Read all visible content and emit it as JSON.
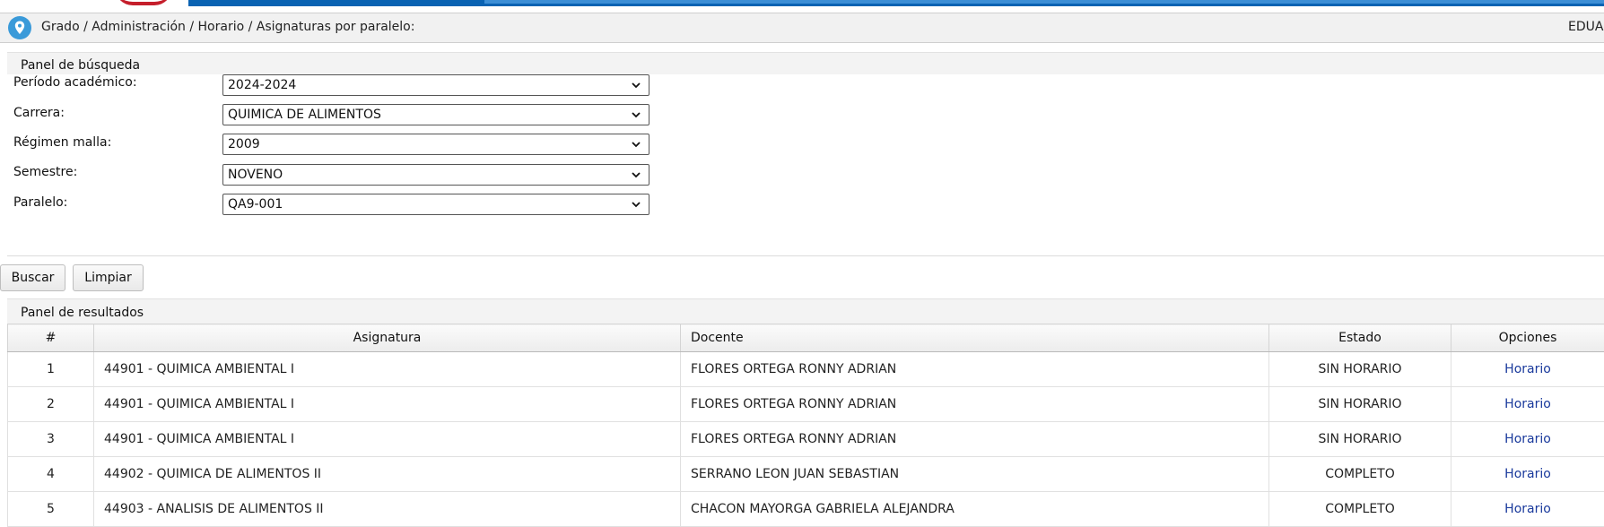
{
  "breadcrumb": {
    "path": "Grado / Administración / Horario / Asignaturas por paralelo:",
    "user": "EDUAR"
  },
  "search_panel": {
    "title": "Panel de búsqueda",
    "fields": [
      {
        "label": "Período académico:",
        "value": "2024-2024"
      },
      {
        "label": "Carrera:",
        "value": "QUIMICA DE ALIMENTOS"
      },
      {
        "label": "Régimen malla:",
        "value": "2009"
      },
      {
        "label": "Semestre:",
        "value": "NOVENO"
      },
      {
        "label": "Paralelo:",
        "value": "QA9-001"
      }
    ]
  },
  "buttons": {
    "search": "Buscar",
    "clear": "Limpiar"
  },
  "results_panel": {
    "title": "Panel de resultados",
    "columns": [
      "#",
      "Asignatura",
      "Docente",
      "Estado",
      "Opciones"
    ],
    "rows": [
      {
        "num": "1",
        "asignatura": "44901 - QUIMICA AMBIENTAL I",
        "docente": "FLORES ORTEGA RONNY ADRIAN",
        "estado": "SIN HORARIO",
        "opcion": "Horario"
      },
      {
        "num": "2",
        "asignatura": "44901 - QUIMICA AMBIENTAL I",
        "docente": "FLORES ORTEGA RONNY ADRIAN",
        "estado": "SIN HORARIO",
        "opcion": "Horario"
      },
      {
        "num": "3",
        "asignatura": "44901 - QUIMICA AMBIENTAL I",
        "docente": "FLORES ORTEGA RONNY ADRIAN",
        "estado": "SIN HORARIO",
        "opcion": "Horario"
      },
      {
        "num": "4",
        "asignatura": "44902 - QUIMICA DE ALIMENTOS II",
        "docente": "SERRANO LEON JUAN SEBASTIAN",
        "estado": "COMPLETO",
        "opcion": "Horario"
      },
      {
        "num": "5",
        "asignatura": "44903 - ANALISIS DE ALIMENTOS II",
        "docente": "CHACON MAYORGA GABRIELA ALEJANDRA",
        "estado": "COMPLETO",
        "opcion": "Horario"
      }
    ]
  },
  "colors": {
    "banner_blue": "#0a63b3",
    "link": "#1a3a9c",
    "location_icon": "#3a9ad9"
  }
}
